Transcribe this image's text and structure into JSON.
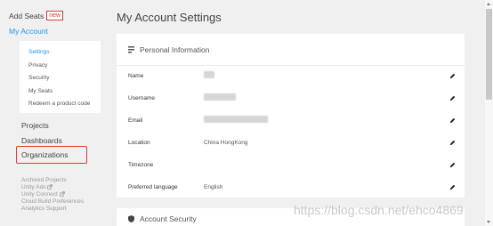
{
  "sidebar": {
    "add_seats": "Add Seats",
    "new_badge": "new",
    "my_account": "My Account",
    "submenu": [
      "Settings",
      "Privacy",
      "Security",
      "My Seats",
      "Redeem a product code"
    ],
    "projects": "Projects",
    "dashboards": "Dashboards",
    "organizations": "Organizations",
    "links": [
      "Archived Projects",
      "Unity Ads",
      "Unity Connect",
      "Cloud Build Preferences",
      "Analytics Support"
    ]
  },
  "main": {
    "title": "My Account Settings",
    "personal_info": {
      "heading": "Personal Information",
      "rows": [
        {
          "label": "Name",
          "value": ""
        },
        {
          "label": "Username",
          "value": ""
        },
        {
          "label": "Email",
          "value": ""
        },
        {
          "label": "Location",
          "value": "China HongKong"
        },
        {
          "label": "Timezone",
          "value": ""
        },
        {
          "label": "Preferred language",
          "value": "English"
        }
      ]
    },
    "account_security": {
      "heading": "Account Security"
    }
  },
  "watermark": "https://blog.csdn.net/ehco4869",
  "colors": {
    "accent": "#2196f3",
    "highlight": "#e53935",
    "background": "#f0f0f0"
  },
  "icons": [
    "document-icon",
    "pencil-icon",
    "shield-icon",
    "external-link-icon"
  ]
}
